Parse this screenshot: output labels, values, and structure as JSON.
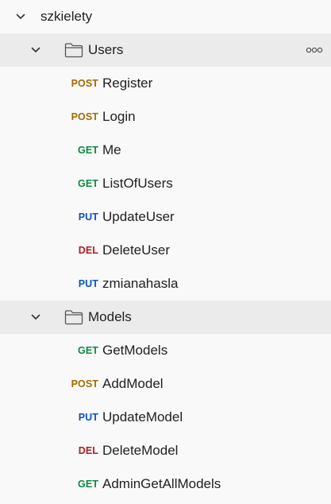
{
  "collection": {
    "name": "szkielety",
    "icon": "chevron-down-icon"
  },
  "folders": [
    {
      "name": "Users",
      "icon": "folder-icon",
      "chevron": "chevron-down-icon",
      "more": "more-horizontal-icon",
      "requests": [
        {
          "method": "POST",
          "name": "Register"
        },
        {
          "method": "POST",
          "name": "Login"
        },
        {
          "method": "GET",
          "name": "Me"
        },
        {
          "method": "GET",
          "name": "ListOfUsers"
        },
        {
          "method": "PUT",
          "name": "UpdateUser"
        },
        {
          "method": "DEL",
          "name": "DeleteUser"
        },
        {
          "method": "PUT",
          "name": "zmianahasla"
        }
      ]
    },
    {
      "name": "Models",
      "icon": "folder-icon",
      "chevron": "chevron-down-icon",
      "requests": [
        {
          "method": "GET",
          "name": "GetModels"
        },
        {
          "method": "POST",
          "name": "AddModel"
        },
        {
          "method": "PUT",
          "name": "UpdateModel"
        },
        {
          "method": "DEL",
          "name": "DeleteModel"
        },
        {
          "method": "GET",
          "name": "AdminGetAllModels"
        }
      ]
    }
  ],
  "method_colors": {
    "GET": "#0b8a3e",
    "POST": "#a36b00",
    "PUT": "#0a53c4",
    "DEL": "#b11e1e"
  }
}
